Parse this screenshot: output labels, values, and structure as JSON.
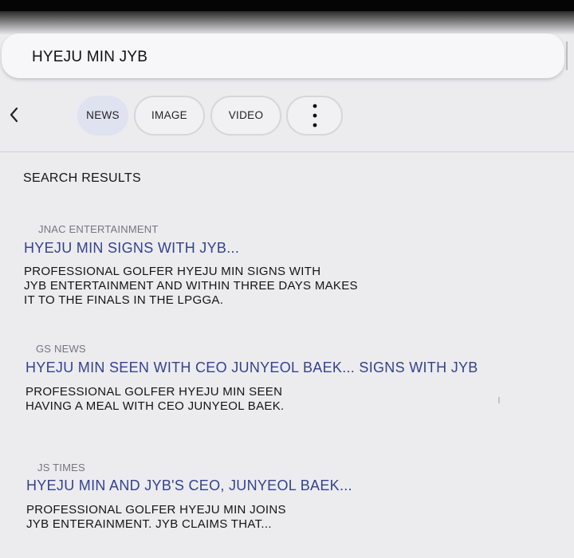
{
  "search": {
    "query": "HYEJU MIN JYB"
  },
  "tabs": [
    {
      "label": "NEWS",
      "active": true
    },
    {
      "label": "IMAGE",
      "active": false
    },
    {
      "label": "VIDEO",
      "active": false
    }
  ],
  "icons": {
    "back": "chevron-left-icon",
    "more": "more-vertical-icon"
  },
  "colors": {
    "title_link": "#34428f",
    "active_tab": "#dfe3ef",
    "source_text": "#77777b"
  },
  "results_heading": "SEARCH RESULTS",
  "results": [
    {
      "source": "JNAC ENTERTAINMENT",
      "title": "HYEJU MIN SIGNS WITH JYB...",
      "snippet": "PROFESSIONAL GOLFER HYEJU MIN SIGNS WITH\nJYB ENTERTAINMENT AND WITHIN THREE DAYS MAKES\nIT TO THE FINALS IN THE LPGGA."
    },
    {
      "source": "GS NEWS",
      "title": "HYEJU MIN SEEN WITH CEO JUNYEOL BAEK... SIGNS WITH JYB",
      "snippet": "PROFESSIONAL GOLFER HYEJU MIN SEEN\nHAVING A MEAL WITH CEO JUNYEOL BAEK."
    },
    {
      "source": "JS TIMES",
      "title": "HYEJU MIN AND JYB'S CEO, JUNYEOL BAEK...",
      "snippet": "PROFESSIONAL GOLFER HYEJU MIN JOINS\nJYB ENTERAINMENT. JYB CLAIMS THAT..."
    }
  ]
}
